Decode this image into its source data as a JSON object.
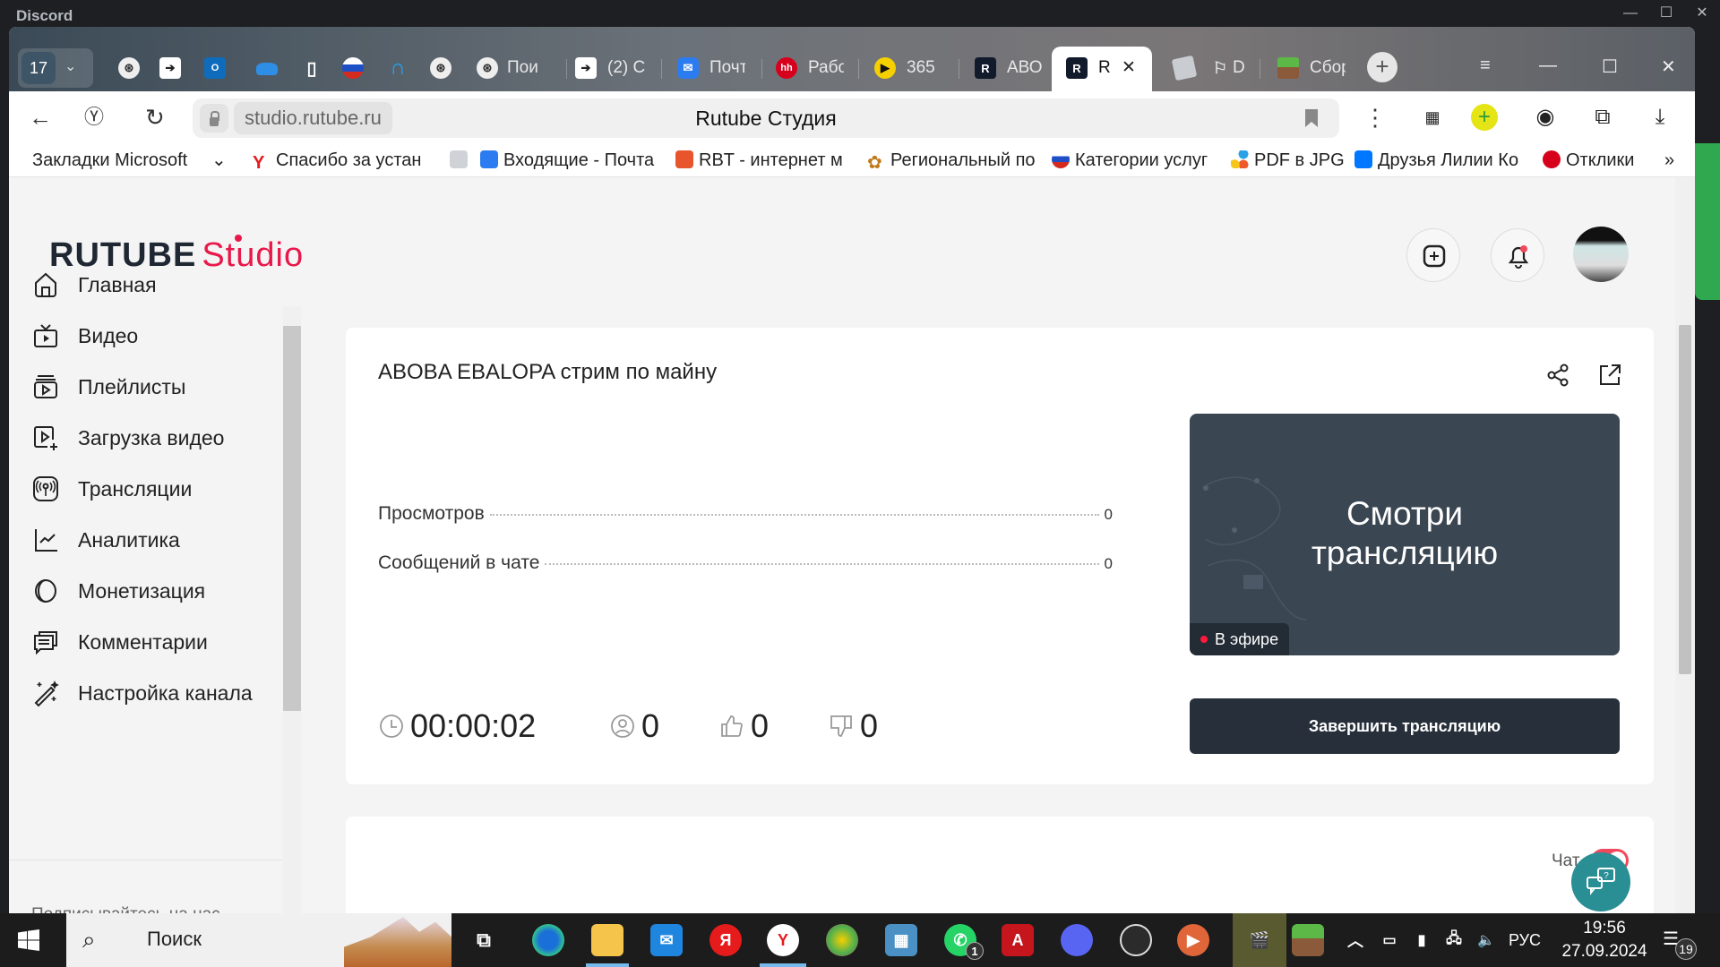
{
  "window": {
    "app_title": "Discord",
    "controls": [
      "minimize-icon",
      "maximize-icon",
      "close-icon"
    ]
  },
  "browser": {
    "tab_count": "17",
    "tabs": [
      {
        "icon": "ai-icon",
        "label": ""
      },
      {
        "icon": "arrow-circle-icon",
        "label": ""
      },
      {
        "icon": "outlook-icon",
        "label": ""
      },
      {
        "icon": "onedrive-icon",
        "label": ""
      },
      {
        "icon": "file-icon",
        "label": ""
      },
      {
        "icon": "gosuslugi-icon",
        "label": ""
      },
      {
        "icon": "alice-icon",
        "label": ""
      },
      {
        "icon": "ai-icon",
        "label": ""
      },
      {
        "icon": "ai-icon",
        "label": "Пои"
      },
      {
        "icon": "arrow-circle-icon",
        "label": "(2) С"
      },
      {
        "icon": "mail-icon",
        "label": "Почт"
      },
      {
        "icon": "hh-icon",
        "label": "Рабо"
      },
      {
        "icon": "play-yellow-icon",
        "label": "365"
      },
      {
        "icon": "rutube-icon",
        "label": "АВО"
      },
      {
        "icon": "rutube-icon",
        "label": "R",
        "active": true
      },
      {
        "icon": "roblox-icon",
        "label": ""
      },
      {
        "icon": "flag-icon",
        "label": "D"
      },
      {
        "icon": "minecraft-icon",
        "label": "Сбор"
      }
    ],
    "url": "studio.rutube.ru",
    "page_title": "Rutube Студия",
    "bookmarks": [
      "Закладки Microsoft",
      "Спасибо за устан",
      "",
      "Входящие - Почта",
      "RBT - интернет м",
      "Региональный по",
      "Категории услуг",
      "PDF в JPG",
      "Друзья Лилии Ко",
      "Отклики"
    ],
    "bookmarks_more": "»"
  },
  "studio": {
    "logo_main": "RUTUBE",
    "logo_sub": "Studio",
    "sidebar": {
      "items": [
        {
          "label": "Главная",
          "icon": "home-icon"
        },
        {
          "label": "Видео",
          "icon": "video-tv-icon"
        },
        {
          "label": "Плейлисты",
          "icon": "playlist-icon"
        },
        {
          "label": "Загрузка видео",
          "icon": "upload-video-icon"
        },
        {
          "label": "Трансляции",
          "icon": "broadcast-icon"
        },
        {
          "label": "Аналитика",
          "icon": "analytics-icon"
        },
        {
          "label": "Монетизация",
          "icon": "monetization-icon"
        },
        {
          "label": "Комментарии",
          "icon": "comments-icon"
        },
        {
          "label": "Настройка канала",
          "icon": "magic-wand-icon"
        }
      ],
      "follow_label": "Подписывайтесь на нас",
      "socials": [
        "vk",
        "ok",
        "telegram",
        "viber",
        "zen"
      ]
    },
    "stream": {
      "title": "ABOBA EBALOPA стрим по майну",
      "stats": [
        {
          "label": "Просмотров",
          "value": "0"
        },
        {
          "label": "Сообщений в чате",
          "value": "0"
        }
      ],
      "preview_text_line1": "Смотри",
      "preview_text_line2": "трансляцию",
      "live_badge": "В эфире",
      "end_button": "Завершить трансляцию",
      "duration": "00:00:02",
      "viewers": "0",
      "likes": "0",
      "dislikes": "0"
    },
    "chat": {
      "label": "Чат",
      "enabled": true
    }
  },
  "taskbar": {
    "search_placeholder": "Поиск",
    "tray_lang": "РУС",
    "time": "19:56",
    "date": "27.09.2024",
    "notifications": "19",
    "whatsapp_badge": "1"
  },
  "colors": {
    "accent": "#e8184a",
    "dark_button": "#262f3a",
    "toggle_on": "#f0485c",
    "help": "#2a8e95"
  }
}
